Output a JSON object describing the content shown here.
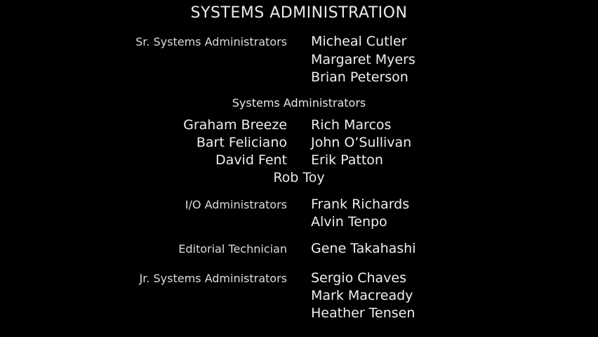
{
  "heading": "SYSTEMS ADMINISTRATION",
  "sr_sysadmins": {
    "role": "Sr. Systems Administrators",
    "names": [
      "Micheal Cutler",
      "Margaret Myers",
      "Brian Peterson"
    ]
  },
  "sysadmins": {
    "role": "Systems Administrators",
    "left_names": [
      "Graham Breeze",
      "Bart Feliciano",
      "David Fent"
    ],
    "right_names": [
      "Rich Marcos",
      "John O’Sullivan",
      "Erik Patton"
    ],
    "center_name": "Rob Toy"
  },
  "io_admins": {
    "role": "I/O Administrators",
    "names": [
      "Frank Richards",
      "Alvin Tenpo"
    ]
  },
  "editorial": {
    "role": "Editorial Technician",
    "names": [
      "Gene Takahashi"
    ]
  },
  "jr_sysadmins": {
    "role": "Jr. Systems Administrators",
    "names": [
      "Sergio Chaves",
      "Mark Macready",
      "Heather Tensen"
    ]
  }
}
